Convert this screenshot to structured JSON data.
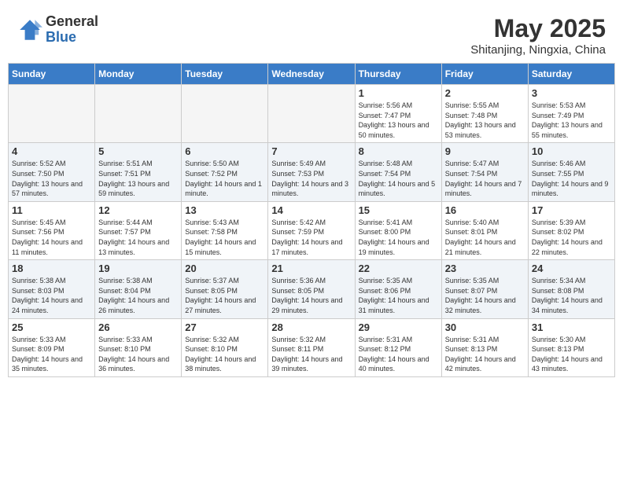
{
  "header": {
    "logo_general": "General",
    "logo_blue": "Blue",
    "main_title": "May 2025",
    "subtitle": "Shitanjing, Ningxia, China"
  },
  "days_of_week": [
    "Sunday",
    "Monday",
    "Tuesday",
    "Wednesday",
    "Thursday",
    "Friday",
    "Saturday"
  ],
  "weeks": [
    {
      "shaded": false,
      "days": [
        {
          "num": "",
          "empty": true
        },
        {
          "num": "",
          "empty": true
        },
        {
          "num": "",
          "empty": true
        },
        {
          "num": "",
          "empty": true
        },
        {
          "num": "1",
          "sunrise": "Sunrise: 5:56 AM",
          "sunset": "Sunset: 7:47 PM",
          "daylight": "Daylight: 13 hours and 50 minutes."
        },
        {
          "num": "2",
          "sunrise": "Sunrise: 5:55 AM",
          "sunset": "Sunset: 7:48 PM",
          "daylight": "Daylight: 13 hours and 53 minutes."
        },
        {
          "num": "3",
          "sunrise": "Sunrise: 5:53 AM",
          "sunset": "Sunset: 7:49 PM",
          "daylight": "Daylight: 13 hours and 55 minutes."
        }
      ]
    },
    {
      "shaded": true,
      "days": [
        {
          "num": "4",
          "sunrise": "Sunrise: 5:52 AM",
          "sunset": "Sunset: 7:50 PM",
          "daylight": "Daylight: 13 hours and 57 minutes."
        },
        {
          "num": "5",
          "sunrise": "Sunrise: 5:51 AM",
          "sunset": "Sunset: 7:51 PM",
          "daylight": "Daylight: 13 hours and 59 minutes."
        },
        {
          "num": "6",
          "sunrise": "Sunrise: 5:50 AM",
          "sunset": "Sunset: 7:52 PM",
          "daylight": "Daylight: 14 hours and 1 minute."
        },
        {
          "num": "7",
          "sunrise": "Sunrise: 5:49 AM",
          "sunset": "Sunset: 7:53 PM",
          "daylight": "Daylight: 14 hours and 3 minutes."
        },
        {
          "num": "8",
          "sunrise": "Sunrise: 5:48 AM",
          "sunset": "Sunset: 7:54 PM",
          "daylight": "Daylight: 14 hours and 5 minutes."
        },
        {
          "num": "9",
          "sunrise": "Sunrise: 5:47 AM",
          "sunset": "Sunset: 7:54 PM",
          "daylight": "Daylight: 14 hours and 7 minutes."
        },
        {
          "num": "10",
          "sunrise": "Sunrise: 5:46 AM",
          "sunset": "Sunset: 7:55 PM",
          "daylight": "Daylight: 14 hours and 9 minutes."
        }
      ]
    },
    {
      "shaded": false,
      "days": [
        {
          "num": "11",
          "sunrise": "Sunrise: 5:45 AM",
          "sunset": "Sunset: 7:56 PM",
          "daylight": "Daylight: 14 hours and 11 minutes."
        },
        {
          "num": "12",
          "sunrise": "Sunrise: 5:44 AM",
          "sunset": "Sunset: 7:57 PM",
          "daylight": "Daylight: 14 hours and 13 minutes."
        },
        {
          "num": "13",
          "sunrise": "Sunrise: 5:43 AM",
          "sunset": "Sunset: 7:58 PM",
          "daylight": "Daylight: 14 hours and 15 minutes."
        },
        {
          "num": "14",
          "sunrise": "Sunrise: 5:42 AM",
          "sunset": "Sunset: 7:59 PM",
          "daylight": "Daylight: 14 hours and 17 minutes."
        },
        {
          "num": "15",
          "sunrise": "Sunrise: 5:41 AM",
          "sunset": "Sunset: 8:00 PM",
          "daylight": "Daylight: 14 hours and 19 minutes."
        },
        {
          "num": "16",
          "sunrise": "Sunrise: 5:40 AM",
          "sunset": "Sunset: 8:01 PM",
          "daylight": "Daylight: 14 hours and 21 minutes."
        },
        {
          "num": "17",
          "sunrise": "Sunrise: 5:39 AM",
          "sunset": "Sunset: 8:02 PM",
          "daylight": "Daylight: 14 hours and 22 minutes."
        }
      ]
    },
    {
      "shaded": true,
      "days": [
        {
          "num": "18",
          "sunrise": "Sunrise: 5:38 AM",
          "sunset": "Sunset: 8:03 PM",
          "daylight": "Daylight: 14 hours and 24 minutes."
        },
        {
          "num": "19",
          "sunrise": "Sunrise: 5:38 AM",
          "sunset": "Sunset: 8:04 PM",
          "daylight": "Daylight: 14 hours and 26 minutes."
        },
        {
          "num": "20",
          "sunrise": "Sunrise: 5:37 AM",
          "sunset": "Sunset: 8:05 PM",
          "daylight": "Daylight: 14 hours and 27 minutes."
        },
        {
          "num": "21",
          "sunrise": "Sunrise: 5:36 AM",
          "sunset": "Sunset: 8:05 PM",
          "daylight": "Daylight: 14 hours and 29 minutes."
        },
        {
          "num": "22",
          "sunrise": "Sunrise: 5:35 AM",
          "sunset": "Sunset: 8:06 PM",
          "daylight": "Daylight: 14 hours and 31 minutes."
        },
        {
          "num": "23",
          "sunrise": "Sunrise: 5:35 AM",
          "sunset": "Sunset: 8:07 PM",
          "daylight": "Daylight: 14 hours and 32 minutes."
        },
        {
          "num": "24",
          "sunrise": "Sunrise: 5:34 AM",
          "sunset": "Sunset: 8:08 PM",
          "daylight": "Daylight: 14 hours and 34 minutes."
        }
      ]
    },
    {
      "shaded": false,
      "days": [
        {
          "num": "25",
          "sunrise": "Sunrise: 5:33 AM",
          "sunset": "Sunset: 8:09 PM",
          "daylight": "Daylight: 14 hours and 35 minutes."
        },
        {
          "num": "26",
          "sunrise": "Sunrise: 5:33 AM",
          "sunset": "Sunset: 8:10 PM",
          "daylight": "Daylight: 14 hours and 36 minutes."
        },
        {
          "num": "27",
          "sunrise": "Sunrise: 5:32 AM",
          "sunset": "Sunset: 8:10 PM",
          "daylight": "Daylight: 14 hours and 38 minutes."
        },
        {
          "num": "28",
          "sunrise": "Sunrise: 5:32 AM",
          "sunset": "Sunset: 8:11 PM",
          "daylight": "Daylight: 14 hours and 39 minutes."
        },
        {
          "num": "29",
          "sunrise": "Sunrise: 5:31 AM",
          "sunset": "Sunset: 8:12 PM",
          "daylight": "Daylight: 14 hours and 40 minutes."
        },
        {
          "num": "30",
          "sunrise": "Sunrise: 5:31 AM",
          "sunset": "Sunset: 8:13 PM",
          "daylight": "Daylight: 14 hours and 42 minutes."
        },
        {
          "num": "31",
          "sunrise": "Sunrise: 5:30 AM",
          "sunset": "Sunset: 8:13 PM",
          "daylight": "Daylight: 14 hours and 43 minutes."
        }
      ]
    }
  ]
}
